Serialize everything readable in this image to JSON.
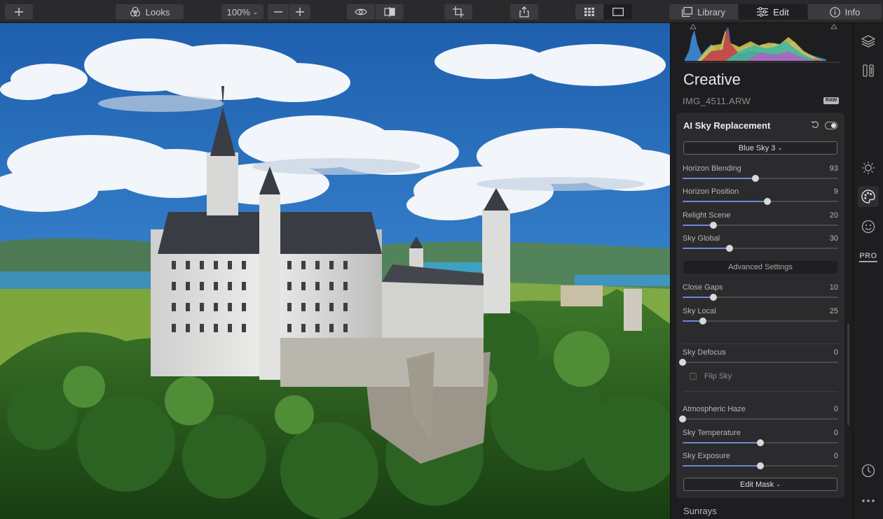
{
  "toolbar": {
    "looks_label": "Looks",
    "zoom_value": "100%",
    "tabs": {
      "library": "Library",
      "edit": "Edit",
      "info": "Info"
    }
  },
  "panel": {
    "title": "Creative",
    "file_name": "IMG_4511.ARW",
    "raw_badge": "RAW",
    "section": {
      "title": "AI Sky Replacement",
      "sky_choice": "Blue Sky 3",
      "advanced_label": "Advanced Settings",
      "sliders": [
        {
          "name": "Horizon Blending",
          "value": "93",
          "fraction": 0.47
        },
        {
          "name": "Horizon Position",
          "value": "9",
          "fraction": 0.545
        },
        {
          "name": "Relight Scene",
          "value": "20",
          "fraction": 0.2
        },
        {
          "name": "Sky Global",
          "value": "30",
          "fraction": 0.3
        },
        {
          "name": "Close Gaps",
          "value": "10",
          "fraction": 0.2
        },
        {
          "name": "Sky Local",
          "value": "25",
          "fraction": 0.13
        },
        {
          "name": "Sky Defocus",
          "value": "0",
          "fraction": 0
        },
        {
          "name": "Atmospheric Haze",
          "value": "0",
          "fraction": 0
        },
        {
          "name": "Sky Temperature",
          "value": "0",
          "fraction": 0.5
        },
        {
          "name": "Sky Exposure",
          "value": "0",
          "fraction": 0.5
        }
      ],
      "flip_sky_label": "Flip Sky",
      "flip_sky_checked": false,
      "edit_mask_label": "Edit Mask"
    },
    "next_section": "Sunrays"
  },
  "rail": {
    "pro_label": "PRO"
  },
  "colors": {
    "accent_slider": "#6f86d6",
    "panel_bg": "#1e1e20",
    "card_bg": "#2b2b2d"
  }
}
